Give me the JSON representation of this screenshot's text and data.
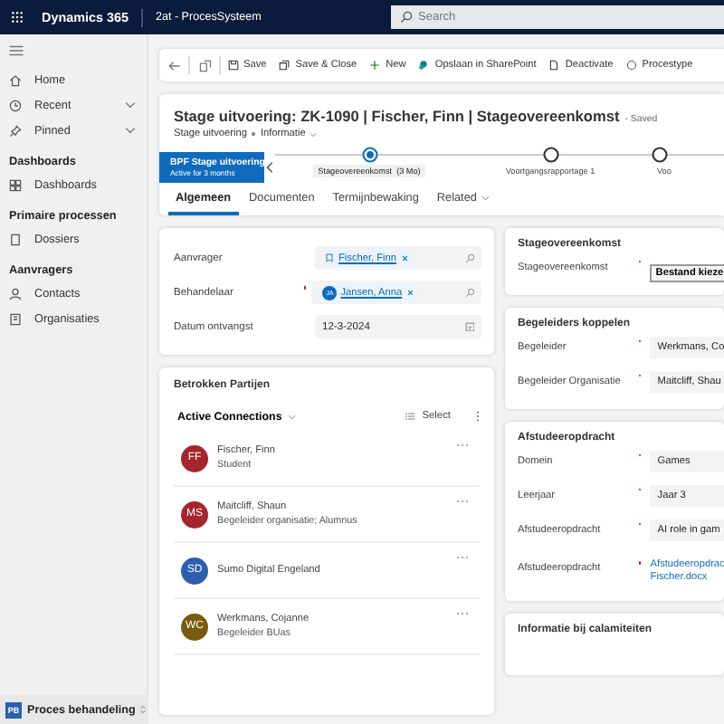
{
  "top_bar": {
    "app_name": "Dynamics 365",
    "environment": "2at - ProcesSysteem",
    "search_placeholder": "Search"
  },
  "sidebar": {
    "items": [
      {
        "kind": "item",
        "label": "Home",
        "expandable": false
      },
      {
        "kind": "item",
        "label": "Recent",
        "expandable": true
      },
      {
        "kind": "item",
        "label": "Pinned",
        "expandable": true
      },
      {
        "kind": "heading",
        "label": "Dashboards"
      },
      {
        "kind": "item",
        "label": "Dashboards",
        "expandable": false
      },
      {
        "kind": "heading",
        "label": "Primaire processen"
      },
      {
        "kind": "item",
        "label": "Dossiers",
        "expandable": false
      },
      {
        "kind": "heading",
        "label": "Aanvragers"
      },
      {
        "kind": "item",
        "label": "Contacts",
        "expandable": false
      },
      {
        "kind": "item",
        "label": "Organisaties",
        "expandable": false
      }
    ],
    "area": {
      "initials": "PB",
      "label": "Proces behandeling"
    }
  },
  "commands": [
    "Save",
    "Save & Close",
    "New",
    "Opslaan in SharePoint",
    "Deactivate",
    "Procestype"
  ],
  "record": {
    "title": "Stage uitvoering: ZK-1090 | Fischer, Finn | Stageovereenkomst",
    "status": "- Saved",
    "entity": "Stage uitvoering",
    "form": "Informatie"
  },
  "bpf": {
    "name": "BPF Stage uitvoering",
    "duration": "Active for 3 months",
    "stages": [
      {
        "label": "Stageovereenkomst  (3 Mo)",
        "selected": true
      },
      {
        "label": "Voortgangsrapportage 1",
        "selected": false
      },
      {
        "label": "Voo",
        "selected": false
      }
    ]
  },
  "tabs": [
    {
      "label": "Algemeen",
      "selected": true
    },
    {
      "label": "Documenten",
      "selected": false
    },
    {
      "label": "Termijnbewaking",
      "selected": false
    },
    {
      "label": "Related",
      "selected": false
    }
  ],
  "general": [
    {
      "label": "Aanvrager",
      "kind": "lookup",
      "value": "Fischer, Finn",
      "required": false
    },
    {
      "label": "Behandelaar",
      "kind": "user",
      "value": "Jansen, Anna",
      "avatar": "JA",
      "required": true
    },
    {
      "label": "Datum ontvangst",
      "kind": "date",
      "value": "12-3-2024",
      "required": false
    }
  ],
  "connections": {
    "title": "Betrokken Partijen",
    "view": "Active Connections",
    "select": "Select",
    "items": [
      {
        "initials": "FF",
        "name": "Fischer, Finn",
        "role": "Student",
        "color": "#a4262c"
      },
      {
        "initials": "MS",
        "name": "Maitcliff, Shaun",
        "role": "Begeleider organisatie; Alumnus",
        "color": "#a4262c"
      },
      {
        "initials": "SD",
        "name": "Sumo Digital Engeland",
        "color": "#2b5fae"
      },
      {
        "initials": "WC",
        "name": "Werkmans, Cojanne",
        "role": "Begeleider BUas",
        "color": "#7a5a0c"
      }
    ]
  },
  "sections": [
    {
      "title": "Stageovereenkomst",
      "fields": [
        {
          "label": "Stageovereenkomst",
          "kind": "button",
          "value": "Bestand kieze"
        }
      ]
    },
    {
      "title": "Begeleiders koppelen",
      "fields": [
        {
          "label": "Begeleider",
          "kind": "text",
          "value": "Werkmans, Co"
        },
        {
          "label": "Begeleider Organisatie",
          "kind": "text",
          "value": "Maitcliff, Shau"
        }
      ]
    },
    {
      "title": "Afstudeeropdracht",
      "fields": [
        {
          "label": "Domein",
          "kind": "text",
          "value": "Games"
        },
        {
          "label": "Leerjaar",
          "kind": "text",
          "value": "Jaar 3"
        },
        {
          "label": "Afstudeeropdracht",
          "kind": "text",
          "value": "AI role in gam"
        },
        {
          "label": "Afstudeeropdracht",
          "kind": "link",
          "value": "Afstudeeropdrac Fischer.docx"
        }
      ]
    },
    {
      "title": "Informatie bij calamiteiten"
    }
  ]
}
